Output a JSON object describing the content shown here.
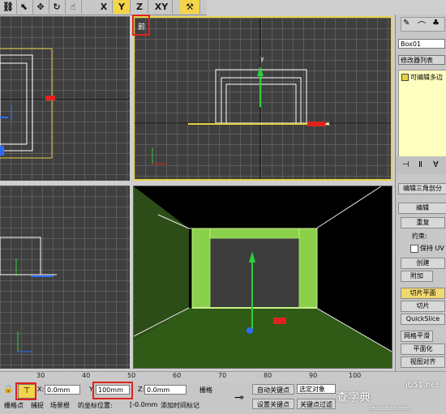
{
  "toolbar": {
    "axis_x": "X",
    "axis_y": "Y",
    "axis_z": "Z",
    "axis_xy": "XY"
  },
  "viewports": {
    "front_label": "前",
    "gizmo_axis_y": "y",
    "gizmo_axis_x": "x"
  },
  "command_panel": {
    "object_name": "Box01",
    "modifier_list": "修改器列表",
    "stack_item": "可编辑多边",
    "rollout_title": "编辑三角剖分",
    "section_edit": "编辑",
    "reset": "重复",
    "constrain": "约束:",
    "preserve_uv": "保持 UV",
    "create": "创建",
    "attach": "附加",
    "slice_plane": "切片平面",
    "slice": "切片",
    "quickslice": "QuickSlice",
    "mesh_smooth": "网格平滑",
    "planarize": "平面化",
    "view_align": "视图对齐"
  },
  "timeline": {
    "ticks": [
      "30",
      "40",
      "50",
      "60",
      "70",
      "80",
      "90",
      "100"
    ]
  },
  "status": {
    "x_label": "X:",
    "x_value": "0.0mm",
    "y_label": "Y:",
    "y_value": "100mm",
    "z_label": "Z:",
    "z_value": "0.0mm",
    "grid_label": "栅格",
    "auto_key": "自动关键点",
    "selected_object": "选定对象",
    "set_key": "设置关键点",
    "key_filter": "关键点过滤",
    "grid_snap": "栅格点",
    "capture": "捕捉",
    "scene_root": "场景根",
    "coords_label": "的坐标位置:",
    "coords_value": "[-0.0mm",
    "add_time_tag": "添加时间标记",
    "watermark_main": "查字典",
    "watermark_sub": "jb51.net",
    "watermark_small": "chazidian.com"
  }
}
